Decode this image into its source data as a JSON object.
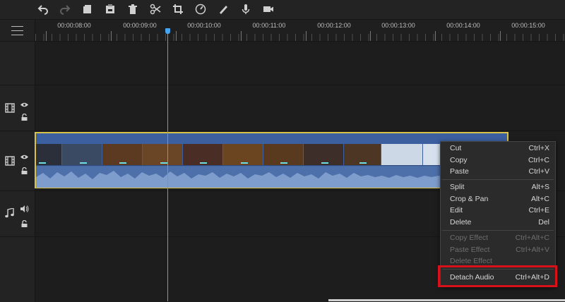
{
  "toolbar": {
    "buttons": [
      {
        "name": "undo-icon",
        "enabled": true
      },
      {
        "name": "redo-icon",
        "enabled": false
      },
      {
        "name": "copy-icon",
        "enabled": true
      },
      {
        "name": "paste-icon",
        "enabled": true
      },
      {
        "name": "delete-icon",
        "enabled": true
      },
      {
        "name": "cut-scissors-icon",
        "enabled": true
      },
      {
        "name": "crop-icon",
        "enabled": true
      },
      {
        "name": "speed-icon",
        "enabled": true
      },
      {
        "name": "edit-pen-icon",
        "enabled": true
      },
      {
        "name": "microphone-icon",
        "enabled": true
      },
      {
        "name": "camera-icon",
        "enabled": true
      }
    ]
  },
  "ruler": {
    "labels": [
      "00:00:08:00",
      "00:00:09:00",
      "00:00:10:00",
      "00:00:11:00",
      "00:00:12:00",
      "00:00:13:00",
      "00:00:14:00",
      "00:00:15:00"
    ]
  },
  "tracks": {
    "empty_video": {
      "icons": [
        "film-icon",
        "eye-icon",
        "lock-icon"
      ]
    },
    "video": {
      "icons": [
        "film-icon",
        "eye-icon",
        "lock-icon"
      ]
    },
    "audio": {
      "icons": [
        "music-note-icon",
        "speaker-icon",
        "lock-icon"
      ]
    }
  },
  "colors": {
    "accent": "#46a5f0",
    "clip_border": "#d8c24a",
    "clip_fill": "#4a6ca6",
    "highlight": "#d8101a"
  },
  "context_menu": {
    "groups": [
      [
        {
          "label": "Cut",
          "shortcut": "Ctrl+X",
          "enabled": true
        },
        {
          "label": "Copy",
          "shortcut": "Ctrl+C",
          "enabled": true
        },
        {
          "label": "Paste",
          "shortcut": "Ctrl+V",
          "enabled": true
        }
      ],
      [
        {
          "label": "Split",
          "shortcut": "Alt+S",
          "enabled": true
        },
        {
          "label": "Crop & Pan",
          "shortcut": "Alt+C",
          "enabled": true
        },
        {
          "label": "Edit",
          "shortcut": "Ctrl+E",
          "enabled": true
        },
        {
          "label": "Delete",
          "shortcut": "Del",
          "enabled": true
        }
      ],
      [
        {
          "label": "Copy Effect",
          "shortcut": "Ctrl+Alt+C",
          "enabled": false
        },
        {
          "label": "Paste Effect",
          "shortcut": "Ctrl+Alt+V",
          "enabled": false
        },
        {
          "label": "Delete Effect",
          "shortcut": "",
          "enabled": false
        }
      ],
      [
        {
          "label": "Detach Audio",
          "shortcut": "Ctrl+Alt+D",
          "enabled": true
        }
      ]
    ]
  }
}
